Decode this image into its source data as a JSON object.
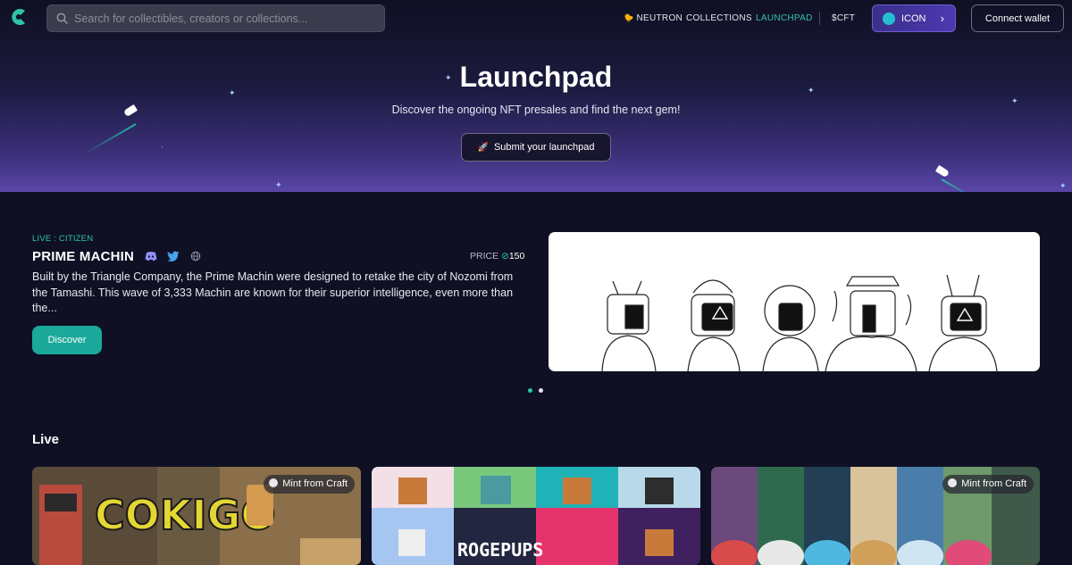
{
  "header": {
    "search_placeholder": "Search for collectibles, creators or collections...",
    "nav": [
      "NEUTRON",
      "COLLECTIONS",
      "LAUNCHPAD",
      "$CFT"
    ],
    "active_nav": "LAUNCHPAD",
    "chain_button_label": "ICON",
    "connect_wallet_label": "Connect wallet"
  },
  "hero": {
    "title": "Launchpad",
    "subtitle": "Discover the ongoing NFT presales and find the next gem!",
    "submit_label": "Submit your launchpad"
  },
  "featured": {
    "status": "LIVE : CITIZEN",
    "name": "PRIME MACHIN",
    "price_label": "PRICE",
    "price_value": "150",
    "description": "Built by the Triangle Company, the Prime Machin were designed to retake the city of Nozomi from the Tamashi. This wave of 3,333 Machin are known for their superior intelligence, even more than the...",
    "discover_label": "Discover",
    "carousel_active_index": 0,
    "carousel_count": 2
  },
  "live": {
    "title": "Live",
    "cards": [
      {
        "tag": "Mint from Craft"
      },
      {
        "tag": ""
      },
      {
        "tag": "Mint from Craft"
      }
    ]
  },
  "colors": {
    "accent": "#2fc4a7",
    "background": "#0f1023",
    "hero_purple": "#5a46a8"
  },
  "icons": [
    "search-icon",
    "discord-icon",
    "twitter-icon",
    "globe-icon",
    "rocket-icon",
    "chevron-right-icon",
    "coin-icon"
  ]
}
